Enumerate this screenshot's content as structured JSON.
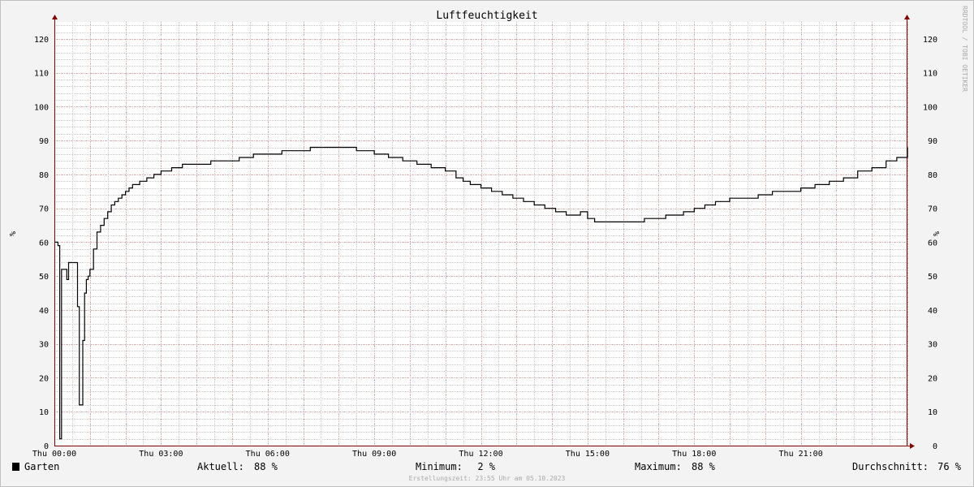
{
  "chart_data": {
    "type": "line",
    "title": "Luftfeuchtigkeit",
    "ylabel": "%",
    "ylim": [
      0,
      125
    ],
    "yticks": [
      0,
      10,
      20,
      30,
      40,
      50,
      60,
      70,
      80,
      90,
      100,
      110,
      120
    ],
    "x_range_hours": [
      0,
      24
    ],
    "xticks": [
      {
        "hour": 0,
        "label": "Thu 00:00"
      },
      {
        "hour": 3,
        "label": "Thu 03:00"
      },
      {
        "hour": 6,
        "label": "Thu 06:00"
      },
      {
        "hour": 9,
        "label": "Thu 09:00"
      },
      {
        "hour": 12,
        "label": "Thu 12:00"
      },
      {
        "hour": 15,
        "label": "Thu 15:00"
      },
      {
        "hour": 18,
        "label": "Thu 18:00"
      },
      {
        "hour": 21,
        "label": "Thu 21:00"
      }
    ],
    "grid": true,
    "series": [
      {
        "name": "Garten",
        "color": "#000000",
        "x_hours": [
          0,
          0.1,
          0.15,
          0.2,
          0.25,
          0.35,
          0.4,
          0.45,
          0.65,
          0.7,
          0.8,
          0.85,
          0.9,
          0.95,
          1.0,
          1.1,
          1.2,
          1.3,
          1.4,
          1.5,
          1.6,
          1.7,
          1.8,
          1.9,
          2.0,
          2.1,
          2.2,
          2.4,
          2.6,
          2.8,
          3.0,
          3.3,
          3.6,
          4.0,
          4.4,
          4.8,
          5.2,
          5.6,
          6.0,
          6.4,
          6.8,
          7.2,
          7.6,
          8.0,
          8.5,
          9.0,
          9.4,
          9.8,
          10.2,
          10.6,
          11.0,
          11.3,
          11.5,
          11.7,
          12.0,
          12.3,
          12.6,
          12.9,
          13.2,
          13.5,
          13.8,
          14.1,
          14.4,
          14.6,
          14.8,
          15.0,
          15.2,
          15.4,
          15.7,
          16.0,
          16.3,
          16.6,
          16.9,
          17.2,
          17.4,
          17.7,
          18.0,
          18.3,
          18.6,
          19.0,
          19.4,
          19.8,
          20.2,
          20.6,
          21.0,
          21.4,
          21.8,
          22.2,
          22.6,
          23.0,
          23.4,
          23.7,
          24.0
        ],
        "values": [
          60,
          59,
          2,
          52,
          52,
          49,
          54,
          54,
          41,
          12,
          31,
          45,
          49,
          50,
          52,
          58,
          63,
          65,
          67,
          69,
          71,
          72,
          73,
          74,
          75,
          76,
          77,
          78,
          79,
          80,
          81,
          82,
          83,
          83,
          84,
          84,
          85,
          86,
          86,
          87,
          87,
          88,
          88,
          88,
          87,
          86,
          85,
          84,
          83,
          82,
          81,
          79,
          78,
          77,
          76,
          75,
          74,
          73,
          72,
          71,
          70,
          69,
          68,
          68,
          69,
          67,
          66,
          66,
          66,
          66,
          66,
          67,
          67,
          68,
          68,
          69,
          70,
          71,
          72,
          73,
          73,
          74,
          75,
          75,
          76,
          77,
          78,
          79,
          81,
          82,
          84,
          85,
          88
        ]
      }
    ]
  },
  "legend": {
    "series_name": "Garten",
    "current_label": "Aktuell:",
    "current_value": "88 %",
    "min_label": "Minimum:",
    "min_value": "2 %",
    "max_label": "Maximum:",
    "max_value": "88 %",
    "avg_label": "Durchschnitt:",
    "avg_value": "76 %"
  },
  "watermark": "RRDTOOL / TOBI OETIKER",
  "footer": "Erstellungszeit: 23:55 Uhr am 05.10.2023",
  "colors": {
    "background": "#f3f3f3",
    "canvas": "#ffffff",
    "minor_grid": "#c8c8c8",
    "major_grid": "#e8a0a0",
    "axis": "#800000",
    "line": "#000000"
  }
}
